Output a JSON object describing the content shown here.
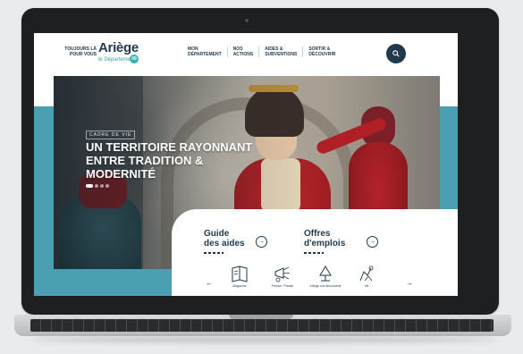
{
  "header": {
    "tagline": "TOUJOURS LÀ POUR VOUS",
    "logo_word": "Ariège",
    "logo_sub": "le Département",
    "logo_badge": "09"
  },
  "nav": {
    "items": [
      {
        "label": "MON\nDÉPARTEMENT"
      },
      {
        "label": "NOS\nACTIONS"
      },
      {
        "label": "AIDES &\nSUBVENTIONS"
      },
      {
        "label": "SORTIR &\nDÉCOUVRIR"
      }
    ]
  },
  "hero": {
    "kicker": "CADRE DE VIE",
    "title": "UN TERRITOIRE RAYONNANT ENTRE TRADITION & MODERNITÉ",
    "slides": 4,
    "active_slide": 1
  },
  "quick_access": {
    "guide_title": "Guide\ndes aides",
    "jobs_title": "Offres\nd'emplois",
    "arrow_glyph": "→",
    "prev_glyph": "←",
    "next_glyph": "→",
    "tiles": [
      {
        "icon": "book-icon",
        "label": "Magazine"
      },
      {
        "icon": "megaphone-icon",
        "label": "Presse / Presse"
      },
      {
        "icon": "tree-icon",
        "label": "Ariège à la découverte"
      },
      {
        "icon": "hands-icon",
        "label": "Vie"
      }
    ]
  },
  "colors": {
    "accent": "#4a9fb3",
    "navy": "#1f3a4f",
    "teal": "#35b3b3",
    "frame": "#1e1f21"
  }
}
